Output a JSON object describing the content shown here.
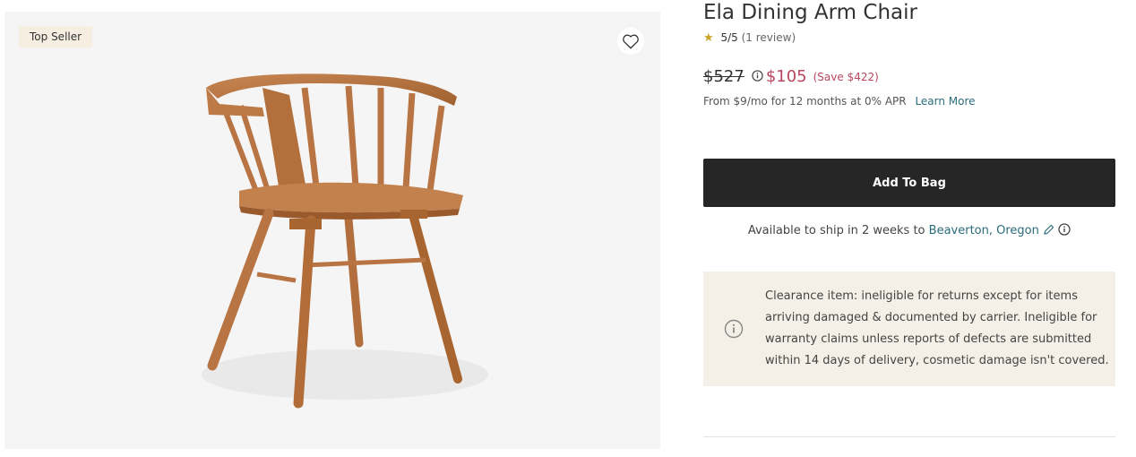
{
  "gallery": {
    "badge": "Top Seller",
    "favorite_icon": "heart-icon",
    "image_subject": "wooden-dining-arm-chair"
  },
  "product": {
    "title": "Ela Dining Arm Chair",
    "rating": {
      "score": "5/5",
      "reviews": "(1 review)",
      "star": "★"
    },
    "price": {
      "original": "$527",
      "sale": "$105",
      "save": "(Save $422)"
    },
    "finance": {
      "text": "From $9/mo for 12 months at 0% APR",
      "link": "Learn More"
    },
    "add_to_bag": "Add To Bag",
    "shipping": {
      "prefix": "Available to ship in 2 weeks to",
      "location": "Beaverton, Oregon"
    },
    "clearance_notice": "Clearance item: ineligible for returns except for items arriving damaged & documented by carrier. Ineligible for warranty claims unless reports of defects are submitted within 14 days of delivery, cosmetic damage isn't covered."
  },
  "colors": {
    "sale_red": "#b9465f",
    "link_teal": "#2b6c7a",
    "button_dark": "#262626",
    "badge_bg": "#f6efe1",
    "notice_bg": "#f4f0e7",
    "star": "#c9a227"
  }
}
